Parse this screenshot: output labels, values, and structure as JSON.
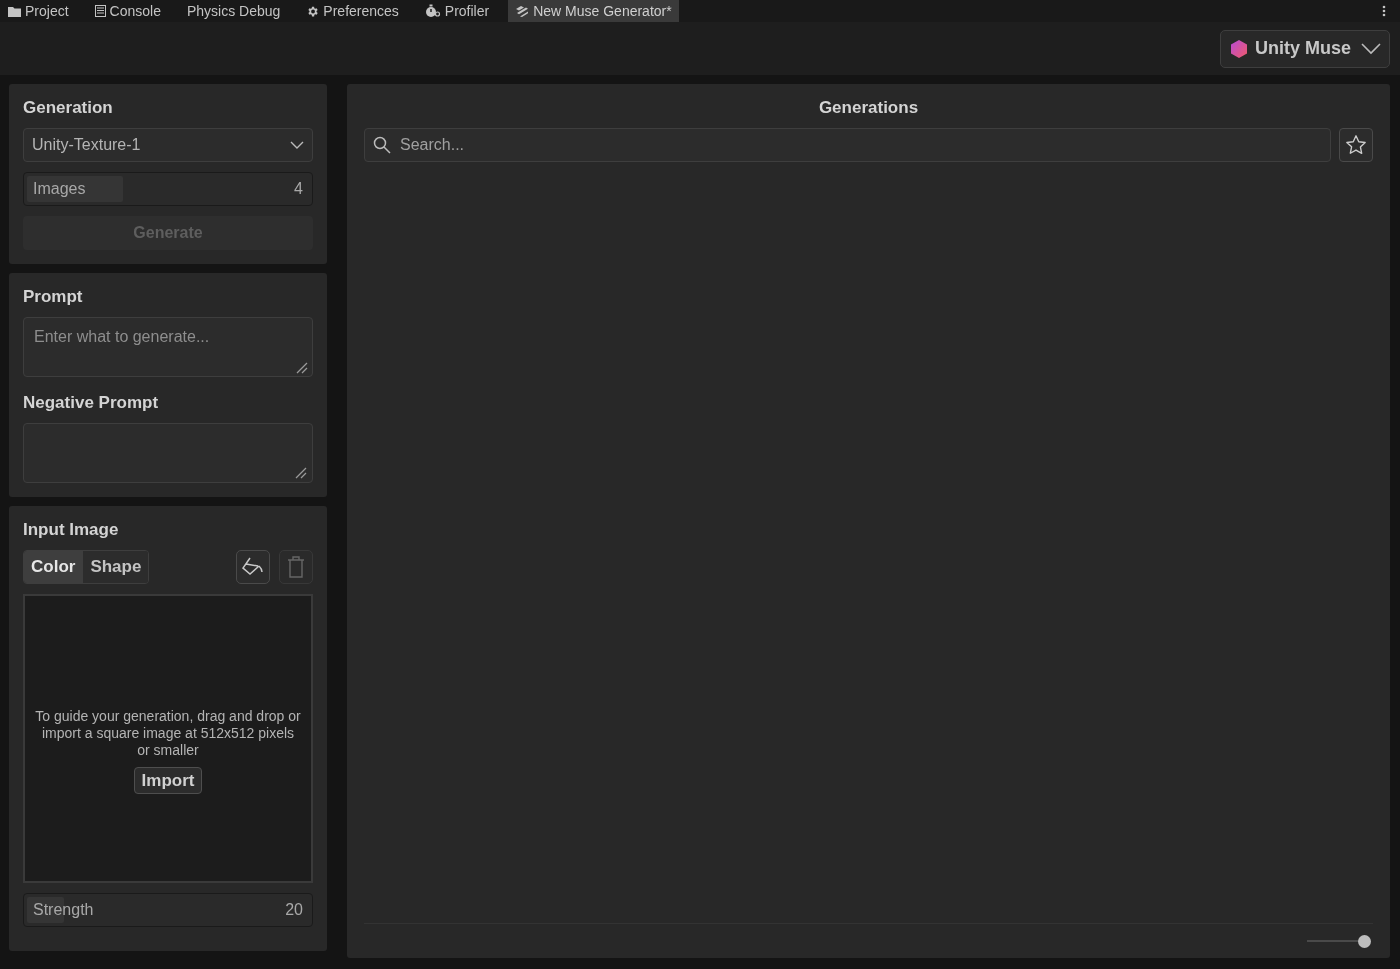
{
  "tabs": [
    {
      "label": "Project",
      "kind": "folder",
      "selected": false
    },
    {
      "label": "Console",
      "kind": "console",
      "selected": false
    },
    {
      "label": "Physics Debug",
      "kind": "plain",
      "selected": false
    },
    {
      "label": "Preferences",
      "kind": "gear",
      "selected": false
    },
    {
      "label": "Profiler",
      "kind": "stopwatch",
      "selected": false
    },
    {
      "label": "New Muse Generator*",
      "kind": "muse",
      "selected": true
    }
  ],
  "account_menu": {
    "label": "Unity Muse"
  },
  "generation": {
    "title": "Generation",
    "model": "Unity-Texture-1",
    "images": {
      "label": "Images",
      "value": "4",
      "level": 0.34
    },
    "generate_button": {
      "label": "Generate",
      "disabled": true
    }
  },
  "prompt": {
    "title": "Prompt",
    "placeholder": "Enter what to generate...",
    "negative_title": "Negative Prompt"
  },
  "input_image": {
    "title": "Input Image",
    "modes": [
      {
        "label": "Color",
        "selected": true
      },
      {
        "label": "Shape",
        "selected": false
      }
    ],
    "hint": "To guide your generation, drag and drop or import a square image at 512x512 pixels or smaller",
    "import_button": "Import",
    "strength": {
      "label": "Strength",
      "value": "20",
      "level": 0.13
    }
  },
  "generations": {
    "title": "Generations",
    "search_placeholder": "Search...",
    "zoom_slider": {
      "level": 1
    }
  }
}
